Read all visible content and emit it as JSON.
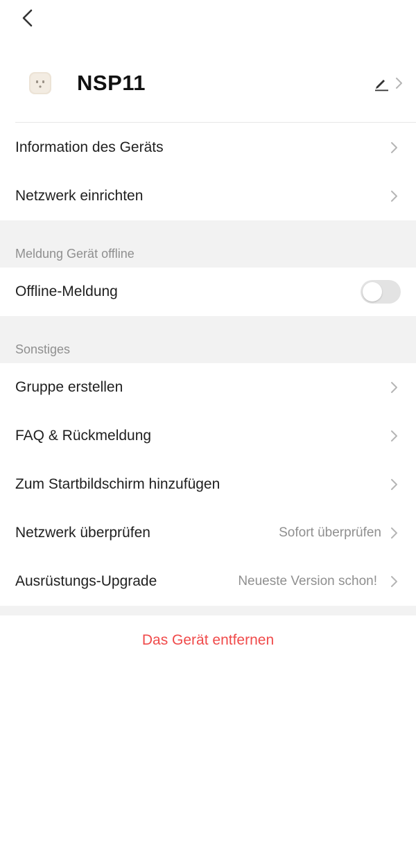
{
  "header": {
    "back_icon": "chevron-left-icon"
  },
  "device": {
    "name": "NSP11",
    "icon": "smart-plug-icon",
    "edit_icon": "pencil-icon"
  },
  "rows_top": [
    {
      "label": "Information des Geräts"
    },
    {
      "label": "Netzwerk einrichten"
    }
  ],
  "offline_section": {
    "title": "Meldung Gerät offline",
    "toggle_label": "Offline-Meldung",
    "toggle_on": false
  },
  "other_section": {
    "title": "Sonstiges",
    "rows": [
      {
        "label": "Gruppe erstellen",
        "value": ""
      },
      {
        "label": "FAQ & Rückmeldung",
        "value": ""
      },
      {
        "label": "Zum Startbildschirm hinzufügen",
        "value": ""
      },
      {
        "label": "Netzwerk überprüfen",
        "value": "Sofort überprüfen"
      },
      {
        "label": "Ausrüstungs-Upgrade",
        "value": "Neueste Version schon!"
      }
    ]
  },
  "remove_label": "Das Gerät entfernen",
  "colors": {
    "danger": "#f04a4a",
    "section_bg": "#f2f2f2",
    "secondary_text": "#8f8f8f"
  }
}
